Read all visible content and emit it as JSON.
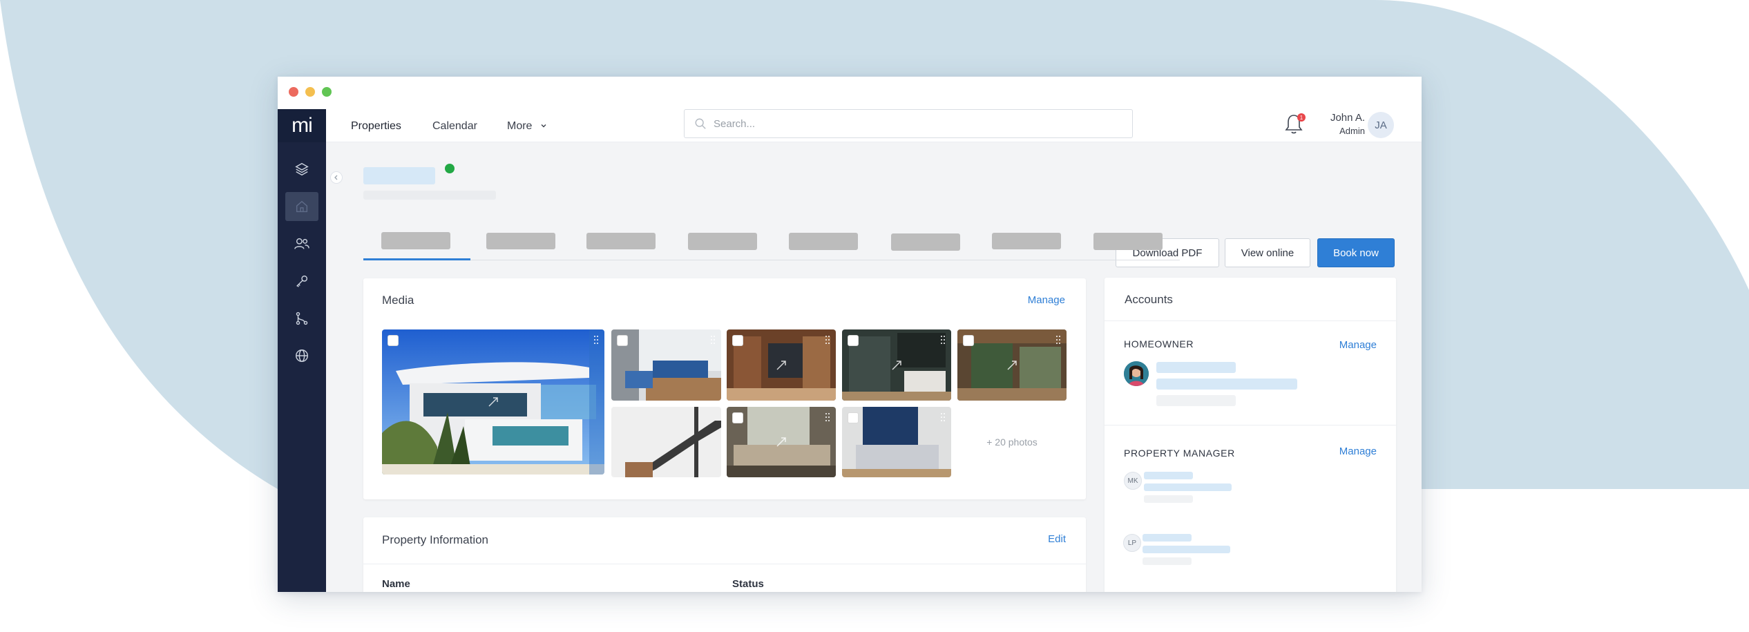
{
  "colors": {
    "background_blob": "#cddfe9",
    "sidebar": "#1b2440",
    "accent": "#2f7fd6",
    "status_online": "#22a845",
    "notification_badge": "#e8474b",
    "skeleton": "#d6e8f7",
    "skeleton_gray": "#bcbcbc"
  },
  "window": {
    "traffic_lights": [
      "close",
      "minimize",
      "maximize"
    ]
  },
  "sidebar": {
    "logo": "mi",
    "items": [
      {
        "icon": "layers-icon",
        "active": false
      },
      {
        "icon": "home-icon",
        "active": true
      },
      {
        "icon": "users-icon",
        "active": false
      },
      {
        "icon": "key-icon",
        "active": false
      },
      {
        "icon": "git-branch-icon",
        "active": false
      },
      {
        "icon": "globe-icon",
        "active": false
      }
    ]
  },
  "topnav": {
    "links": [
      "Properties",
      "Calendar",
      "More"
    ],
    "search": {
      "placeholder": "Search...",
      "value": ""
    },
    "notifications": {
      "count": "1"
    },
    "user": {
      "name": "John A.",
      "role": "Admin",
      "initials": "JA"
    }
  },
  "header": {
    "status": "online",
    "buttons": {
      "download_pdf": "Download PDF",
      "view_online": "View online",
      "book_now": "Book now"
    },
    "tab_count": 8,
    "active_tab": 0
  },
  "media": {
    "title": "Media",
    "manage": "Manage",
    "more_photos": "+ 20 photos"
  },
  "property_info": {
    "title": "Property Information",
    "edit": "Edit",
    "columns": [
      "Name",
      "Status"
    ]
  },
  "accounts": {
    "title": "Accounts",
    "homeowner": {
      "label": "HOMEOWNER",
      "manage": "Manage"
    },
    "property_manager": {
      "label": "PROPERTY MANAGER",
      "manage": "Manage",
      "members": [
        {
          "initials": "MK"
        },
        {
          "initials": "LP"
        }
      ]
    }
  }
}
